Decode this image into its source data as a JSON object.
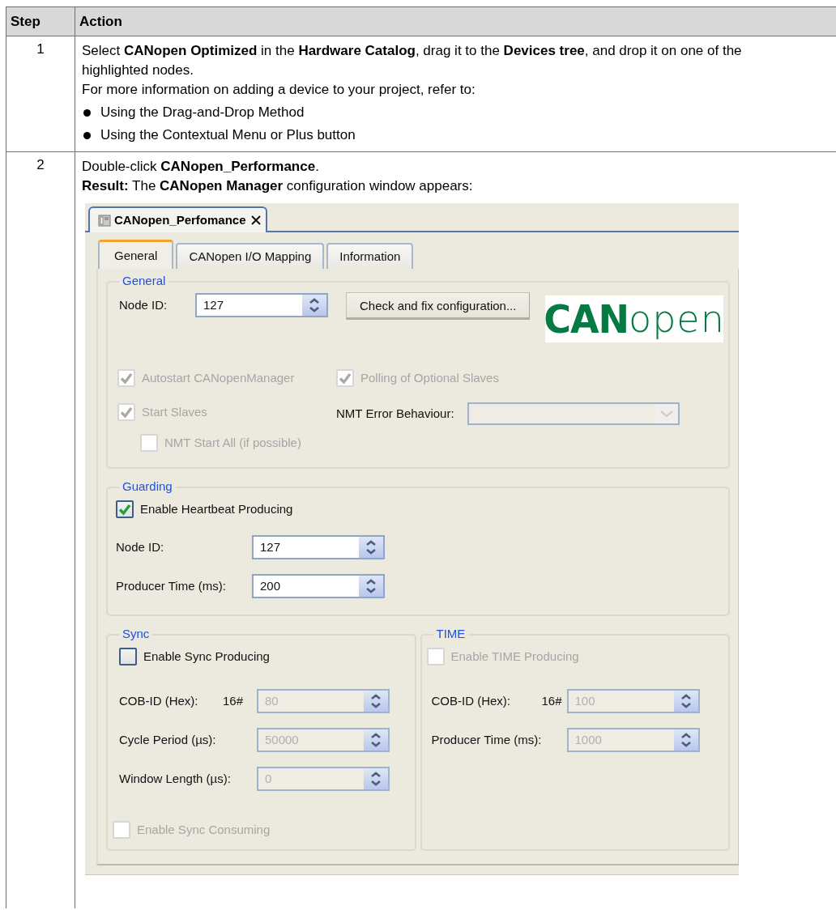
{
  "table": {
    "columns": [
      "Step",
      "Action"
    ],
    "rows": [
      {
        "step": "1",
        "paragraphs": [
          "Select **CANopen Optimized** in the **Hardware Catalog**, drag it to the **Devices tree**, and drop it on one of the highlighted nodes.",
          "For more information on adding a device to your project, refer to:"
        ],
        "bullets": [
          "Using the Drag-and-Drop Method",
          "Using the Contextual Menu or Plus button"
        ]
      },
      {
        "step": "2",
        "paragraphs": [
          "Double-click **CANopen_Performance**.",
          "**Result:** The **CANopen Manager** configuration window appears:"
        ],
        "window": {
          "document_tab": {
            "title": "CANopen_Perfomance"
          },
          "tabs": [
            {
              "label": "General",
              "selected": true
            },
            {
              "label": "CANopen I/O Mapping",
              "selected": false
            },
            {
              "label": "Information",
              "selected": false
            }
          ],
          "general": {
            "title": "General",
            "node_id": {
              "label": "Node ID:",
              "value": "127",
              "disabled": false
            },
            "button": "Check and fix configuration...",
            "logo": {
              "strong": "CAN",
              "light": "open"
            },
            "options": [
              {
                "label": "Autostart CANopenManager",
                "checked": true,
                "disabled": true
              },
              {
                "label": "Polling of Optional Slaves",
                "checked": true,
                "disabled": true
              },
              {
                "label": "Start Slaves",
                "checked": true,
                "disabled": true,
                "children": [
                  {
                    "label": "NMT Start All (if possible)",
                    "checked": false,
                    "disabled": true
                  }
                ]
              }
            ],
            "nmt_error_behaviour": {
              "label": "NMT Error Behaviour:",
              "disabled": true
            }
          },
          "guarding": {
            "title": "Guarding",
            "enable": {
              "label": "Enable Heartbeat Producing",
              "checked": true,
              "disabled": false
            },
            "fields": [
              {
                "label": "Node ID:",
                "value": "127",
                "disabled": false
              },
              {
                "label": "Producer Time (ms):",
                "value": "200",
                "disabled": false
              }
            ]
          },
          "sync": {
            "title": "Sync",
            "enable": {
              "label": "Enable Sync Producing",
              "checked": false,
              "disabled": false
            },
            "fields": [
              {
                "label": "COB-ID (Hex):",
                "prefix": "16#",
                "value": "80",
                "disabled": true
              },
              {
                "label": "Cycle Period (µs):",
                "value": "50000",
                "disabled": true
              },
              {
                "label": "Window Length (µs):",
                "value": "0",
                "disabled": true
              }
            ],
            "consume": {
              "label": "Enable Sync Consuming",
              "checked": false,
              "disabled": true
            }
          },
          "time": {
            "title": "TIME",
            "enable": {
              "label": "Enable TIME Producing",
              "checked": false,
              "disabled": true
            },
            "fields": [
              {
                "label": "COB-ID (Hex):",
                "prefix": "16#",
                "value": "100",
                "disabled": true
              },
              {
                "label": "Producer Time (ms):",
                "value": "1000",
                "disabled": true
              }
            ]
          }
        }
      }
    ]
  }
}
